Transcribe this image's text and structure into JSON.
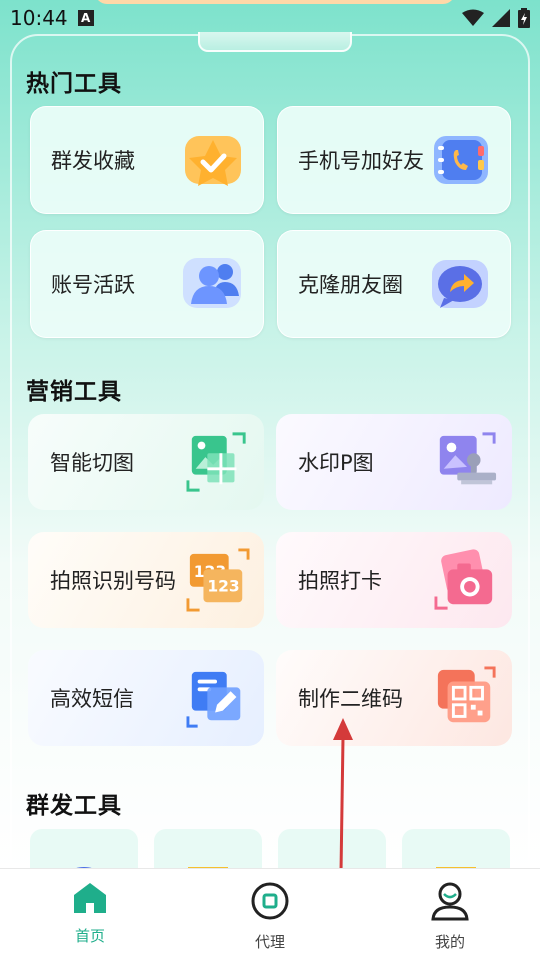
{
  "status": {
    "time": "10:44",
    "notification_icon": "A"
  },
  "sections": {
    "hot": {
      "title": "热门工具",
      "items": [
        {
          "label": "群发收藏",
          "icon": "star-check-icon"
        },
        {
          "label": "手机号加好友",
          "icon": "phone-book-icon"
        },
        {
          "label": "账号活跃",
          "icon": "users-icon"
        },
        {
          "label": "克隆朋友圈",
          "icon": "share-arrow-icon"
        }
      ]
    },
    "marketing": {
      "title": "营销工具",
      "items": [
        {
          "label": "智能切图",
          "icon": "image-crop-icon"
        },
        {
          "label": "水印P图",
          "icon": "watermark-stamp-icon"
        },
        {
          "label": "拍照识别号码",
          "icon": "number-scan-icon"
        },
        {
          "label": "拍照打卡",
          "icon": "camera-icon"
        },
        {
          "label": "高效短信",
          "icon": "sms-edit-icon"
        },
        {
          "label": "制作二维码",
          "icon": "qrcode-icon"
        }
      ]
    },
    "mass": {
      "title": "群发工具"
    }
  },
  "nav": {
    "home": "首页",
    "agent": "代理",
    "mine": "我的"
  },
  "colors": {
    "accent": "#1fae8b"
  }
}
